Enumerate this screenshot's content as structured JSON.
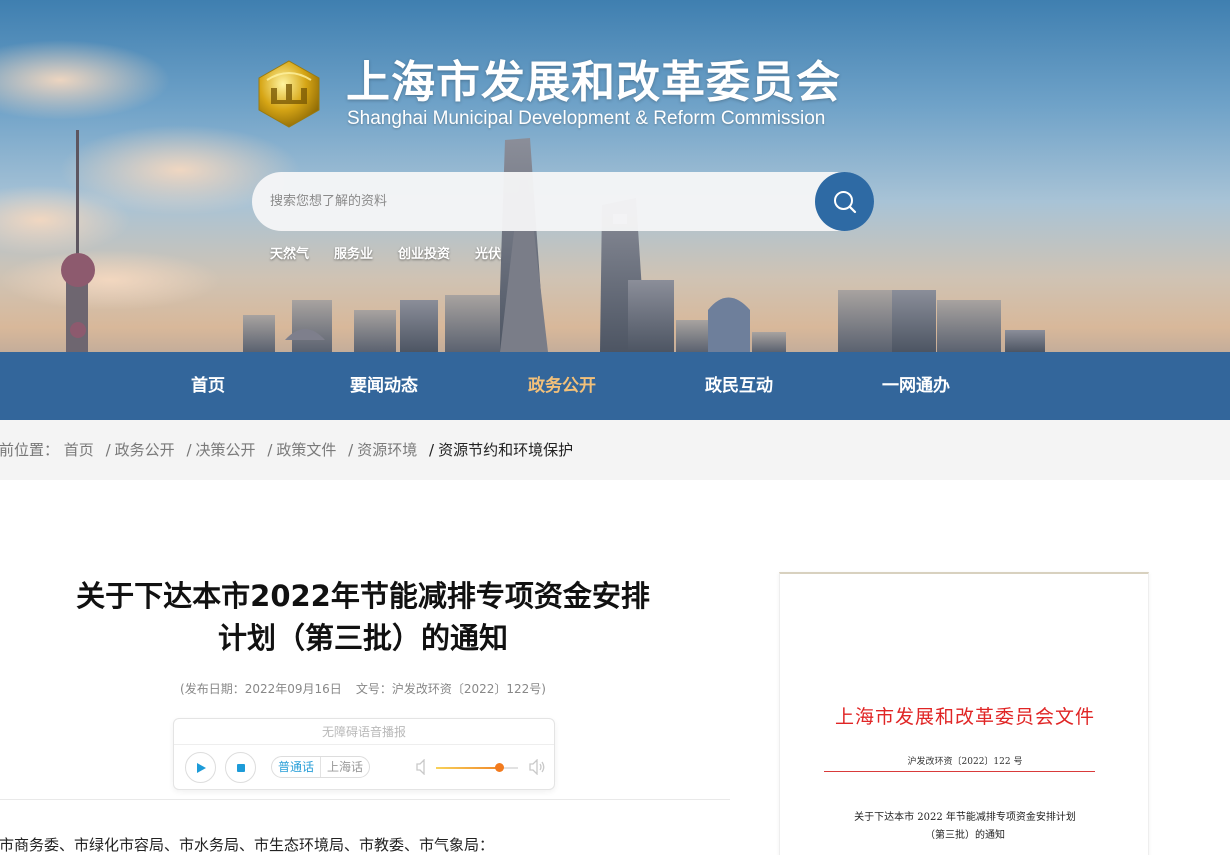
{
  "header": {
    "title": "上海市发展和改革委员会",
    "subtitle": "Shanghai Municipal Development & Reform Commission",
    "logo_icon": "shanghai-drc-emblem-icon",
    "colors": {
      "nav_bg": "#2d69a5",
      "nav_active": "#f3c17a",
      "search_button": "#2e6aa4"
    }
  },
  "search": {
    "placeholder": "搜索您想了解的资料",
    "button_icon": "search-icon"
  },
  "hot_words": [
    "天然气",
    "服务业",
    "创业投资",
    "光伏"
  ],
  "nav": {
    "items": [
      {
        "label": "首页"
      },
      {
        "label": "要闻动态"
      },
      {
        "label": "政务公开"
      },
      {
        "label": "政民互动"
      },
      {
        "label": "一网通办"
      }
    ],
    "active": "政务公开"
  },
  "breadcrumb": {
    "prefix": "前位置：",
    "items": [
      "首页",
      "政务公开",
      "决策公开",
      "政策文件",
      "资源环境",
      "资源节约和环境保护"
    ]
  },
  "article": {
    "title_line1": "关于下达本市2022年节能减排专项资金安排",
    "title_line2": "计划（第三批）的通知",
    "publish_date": "(发布日期：2022年09月16日",
    "doc_number": "文号：沪发改环资〔2022〕122号)",
    "recipients": "市商务委、市绿化市容局、市水务局、市生态环境局、市教委、市气象局："
  },
  "audio_player": {
    "header": "无障碍语音播报",
    "play_icon": "play-icon",
    "stop_icon": "stop-icon",
    "lang_options": [
      "普通话",
      "上海话"
    ],
    "selected_lang": "普通话",
    "volume_fraction": 0.77
  },
  "document_preview": {
    "org": "上海市发展和改革委员会文件",
    "number": "沪发改环资〔2022〕122 号",
    "title_line1": "关于下达本市 2022 年节能减排专项资金安排计划",
    "title_line2": "（第三批）的通知"
  }
}
